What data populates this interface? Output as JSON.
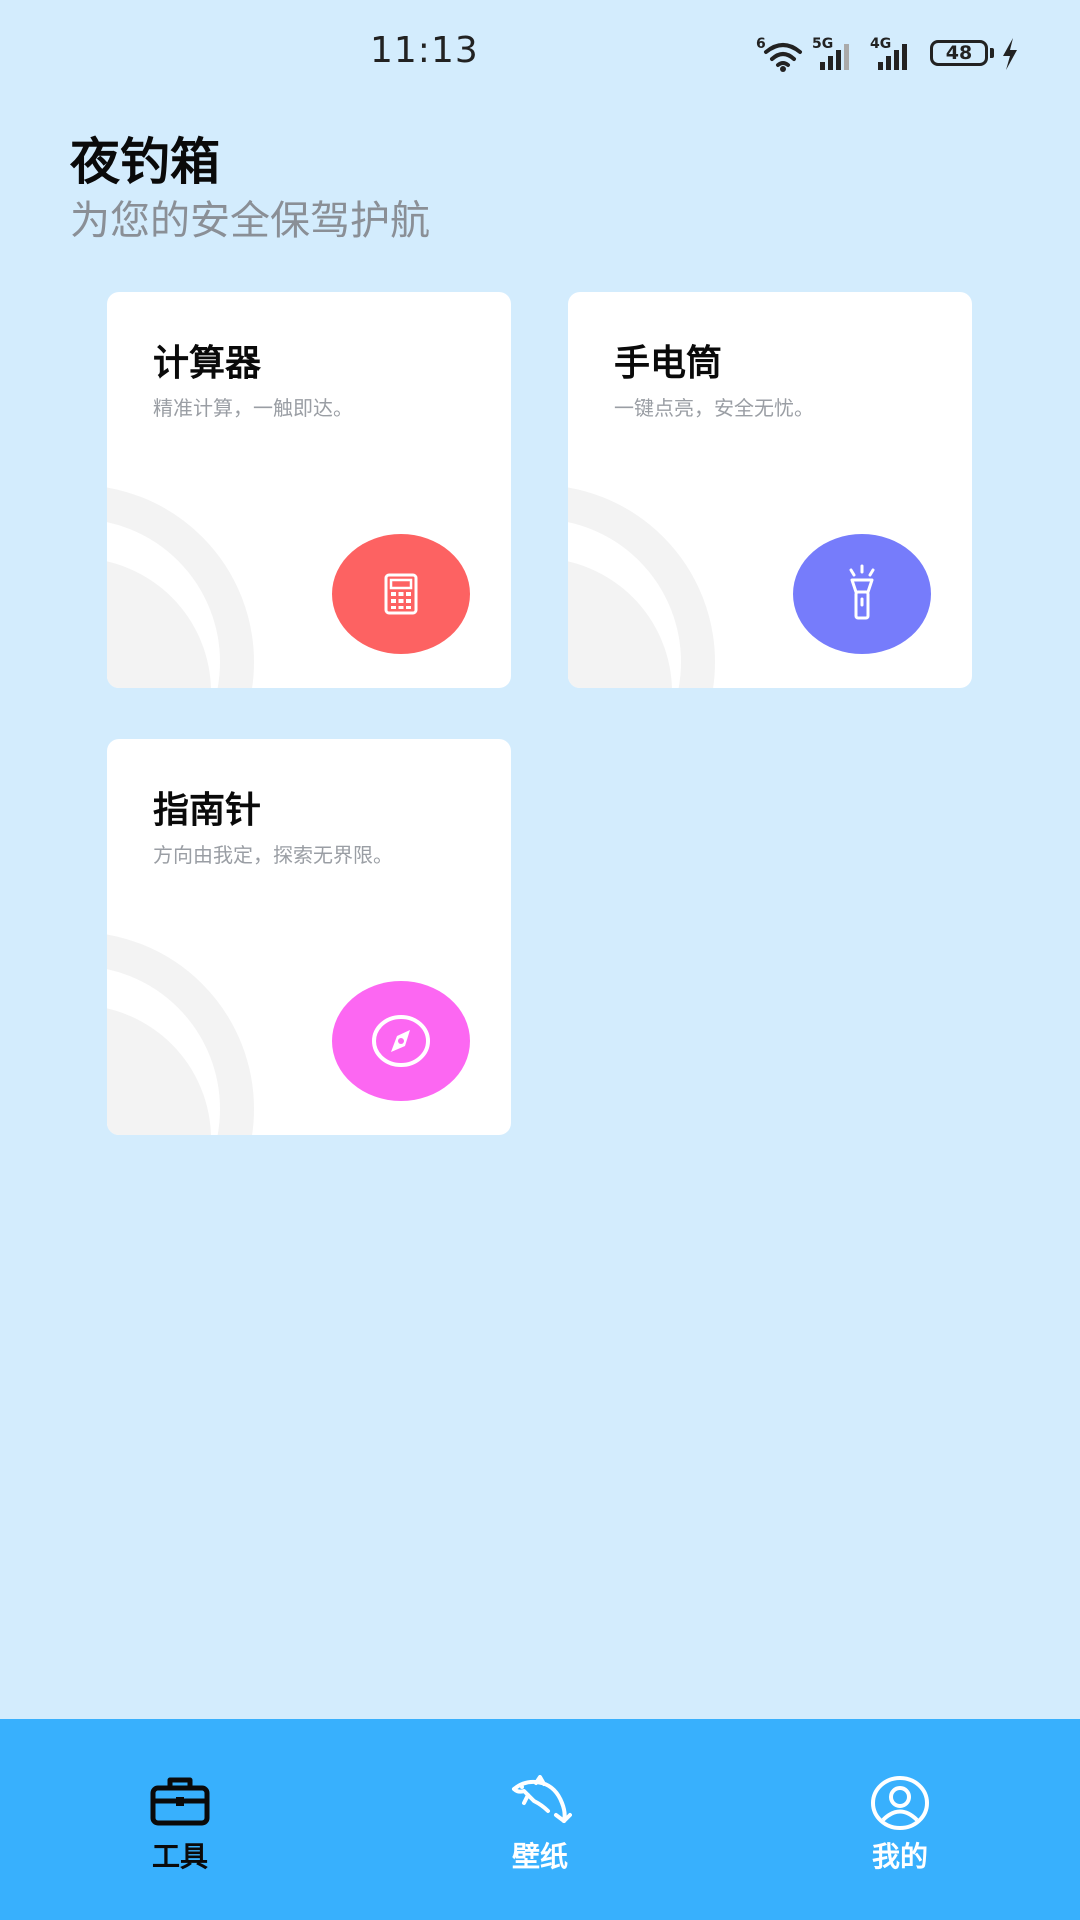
{
  "status_bar": {
    "time": "11:13",
    "battery": "48",
    "wifi_label": "6",
    "sim1_label": "5G",
    "sim2_label": "4G",
    "icons": [
      "wifi-icon",
      "signal-5g-icon",
      "signal-4g-icon",
      "battery-icon",
      "charging-icon"
    ]
  },
  "header": {
    "title": "夜钓箱",
    "subtitle": "为您的安全保驾护航"
  },
  "tools": [
    {
      "title": "计算器",
      "desc": "精准计算，一触即达。",
      "icon": "calculator-icon",
      "color": "#fd6262"
    },
    {
      "title": "手电筒",
      "desc": "一键点亮，安全无忧。",
      "icon": "flashlight-icon",
      "color": "#767cfb"
    },
    {
      "title": "指南针",
      "desc": "方向由我定，探索无界限。",
      "icon": "compass-icon",
      "color": "#fc67f2"
    }
  ],
  "nav": {
    "items": [
      {
        "label": "工具",
        "icon": "toolbox-icon",
        "active": true
      },
      {
        "label": "壁纸",
        "icon": "dolphin-icon",
        "active": false
      },
      {
        "label": "我的",
        "icon": "user-icon",
        "active": false
      }
    ],
    "background": "#38b0fd",
    "active_color": "#0a0a0a",
    "inactive_color": "#ffffff"
  },
  "colors": {
    "page_background": "#d3ecfd",
    "card_background": "#ffffff"
  }
}
